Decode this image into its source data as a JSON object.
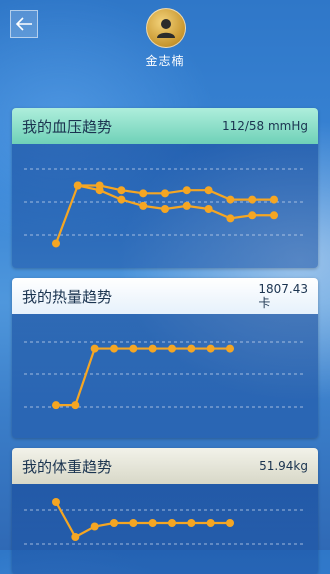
{
  "header": {
    "back_icon": "arrow-left-icon",
    "avatar_icon": "user-silhouette-icon",
    "username": "金志楠"
  },
  "cards": {
    "blood_pressure": {
      "title": "我的血压趋势",
      "value": "112/58 mmHg"
    },
    "calories": {
      "title": "我的热量趋势",
      "value_line1": "1807.43",
      "value_line2": "卡"
    },
    "weight": {
      "title": "我的体重趋势",
      "value": "51.94kg"
    }
  },
  "colors": {
    "accent_orange": "#f5a623",
    "grid_line": "#c9d7ee",
    "bp_header": "#8fe0c8",
    "heat_header": "#f2f7fd",
    "weight_header": "#e6e6da"
  },
  "chart_data": [
    {
      "type": "line",
      "title": "我的血压趋势",
      "x": [
        1,
        2,
        3,
        4,
        5,
        6,
        7,
        8,
        9,
        10,
        11
      ],
      "series": [
        {
          "values": [
            null,
            125,
            125,
            122,
            120,
            120,
            122,
            122,
            116,
            116,
            116
          ]
        },
        {
          "values": [
            88,
            125,
            122,
            116,
            112,
            110,
            112,
            110,
            104,
            106,
            106
          ]
        }
      ],
      "ylim": [
        80,
        140
      ],
      "grid": true
    },
    {
      "type": "line",
      "title": "我的热量趋势",
      "x": [
        1,
        2,
        3,
        4,
        5,
        6,
        7,
        8,
        9,
        10
      ],
      "series": [
        {
          "values": [
            900,
            900,
            1800,
            1800,
            1800,
            1800,
            1800,
            1800,
            1800,
            1800
          ]
        }
      ],
      "ylim": [
        600,
        2000
      ],
      "grid": true
    },
    {
      "type": "line",
      "title": "我的体重趋势",
      "x": [
        1,
        2,
        3,
        4,
        5,
        6,
        7,
        8,
        9,
        10
      ],
      "series": [
        {
          "values": [
            53.2,
            51.2,
            51.8,
            52.0,
            52.0,
            52.0,
            52.0,
            52.0,
            52.0,
            52.0
          ]
        }
      ],
      "ylim": [
        50,
        54
      ],
      "grid": true
    }
  ]
}
